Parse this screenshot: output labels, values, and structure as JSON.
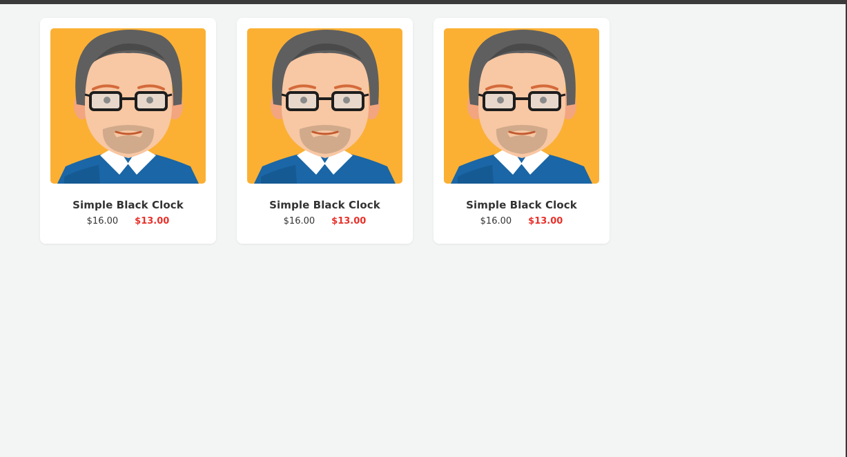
{
  "colors": {
    "page_background": "#f3f5f4",
    "card_background": "#ffffff",
    "thumbnail_background": "#fbb034",
    "sale_price": "#e8302a",
    "text": "#333333"
  },
  "products": [
    {
      "image_icon": "cartoon-man-with-glasses-avatar",
      "name": "Simple Black Clock",
      "price": "$16.00",
      "sale_price": "$13.00"
    },
    {
      "image_icon": "cartoon-man-with-glasses-avatar",
      "name": "Simple Black Clock",
      "price": "$16.00",
      "sale_price": "$13.00"
    },
    {
      "image_icon": "cartoon-man-with-glasses-avatar",
      "name": "Simple Black Clock",
      "price": "$16.00",
      "sale_price": "$13.00"
    }
  ]
}
